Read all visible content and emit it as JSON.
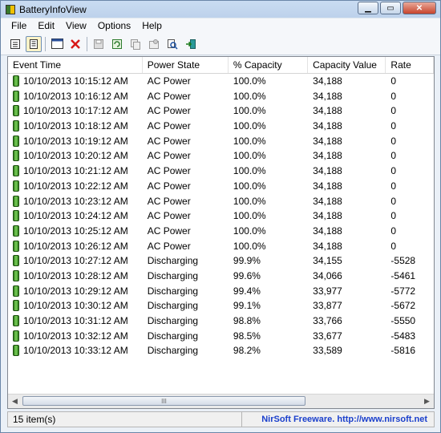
{
  "window": {
    "title": "BatteryInfoView",
    "minimize_glyph": "▁",
    "maximize_glyph": "▭",
    "close_glyph": "✕"
  },
  "menu": [
    "File",
    "Edit",
    "View",
    "Options",
    "Help"
  ],
  "toolbar": {
    "icons": [
      "properties-icon",
      "battery-log-icon",
      "html-report-icon",
      "delete-icon",
      "save-icon",
      "refresh-icon",
      "copy-icon",
      "settings-icon",
      "find-icon",
      "exit-icon"
    ]
  },
  "table": {
    "columns": [
      "Event Time",
      "Power State",
      "% Capacity",
      "Capacity Value",
      "Rate"
    ],
    "rows": [
      [
        "10/10/2013 10:15:12 AM",
        "AC Power",
        "100.0%",
        "34,188",
        "0"
      ],
      [
        "10/10/2013 10:16:12 AM",
        "AC Power",
        "100.0%",
        "34,188",
        "0"
      ],
      [
        "10/10/2013 10:17:12 AM",
        "AC Power",
        "100.0%",
        "34,188",
        "0"
      ],
      [
        "10/10/2013 10:18:12 AM",
        "AC Power",
        "100.0%",
        "34,188",
        "0"
      ],
      [
        "10/10/2013 10:19:12 AM",
        "AC Power",
        "100.0%",
        "34,188",
        "0"
      ],
      [
        "10/10/2013 10:20:12 AM",
        "AC Power",
        "100.0%",
        "34,188",
        "0"
      ],
      [
        "10/10/2013 10:21:12 AM",
        "AC Power",
        "100.0%",
        "34,188",
        "0"
      ],
      [
        "10/10/2013 10:22:12 AM",
        "AC Power",
        "100.0%",
        "34,188",
        "0"
      ],
      [
        "10/10/2013 10:23:12 AM",
        "AC Power",
        "100.0%",
        "34,188",
        "0"
      ],
      [
        "10/10/2013 10:24:12 AM",
        "AC Power",
        "100.0%",
        "34,188",
        "0"
      ],
      [
        "10/10/2013 10:25:12 AM",
        "AC Power",
        "100.0%",
        "34,188",
        "0"
      ],
      [
        "10/10/2013 10:26:12 AM",
        "AC Power",
        "100.0%",
        "34,188",
        "0"
      ],
      [
        "10/10/2013 10:27:12 AM",
        "Discharging",
        "99.9%",
        "34,155",
        "-5528"
      ],
      [
        "10/10/2013 10:28:12 AM",
        "Discharging",
        "99.6%",
        "34,066",
        "-5461"
      ],
      [
        "10/10/2013 10:29:12 AM",
        "Discharging",
        "99.4%",
        "33,977",
        "-5772"
      ],
      [
        "10/10/2013 10:30:12 AM",
        "Discharging",
        "99.1%",
        "33,877",
        "-5672"
      ],
      [
        "10/10/2013 10:31:12 AM",
        "Discharging",
        "98.8%",
        "33,766",
        "-5550"
      ],
      [
        "10/10/2013 10:32:12 AM",
        "Discharging",
        "98.5%",
        "33,677",
        "-5483"
      ],
      [
        "10/10/2013 10:33:12 AM",
        "Discharging",
        "98.2%",
        "33,589",
        "-5816"
      ]
    ]
  },
  "scrollbar": {
    "left_arrow": "◀",
    "right_arrow": "▶",
    "thumb_grip": "III"
  },
  "status": {
    "count": "15 item(s)",
    "link": "NirSoft Freeware.  http://www.nirsoft.net"
  },
  "colors": {
    "link": "#1a3fcc",
    "battery_green": "#2f7d1d"
  }
}
